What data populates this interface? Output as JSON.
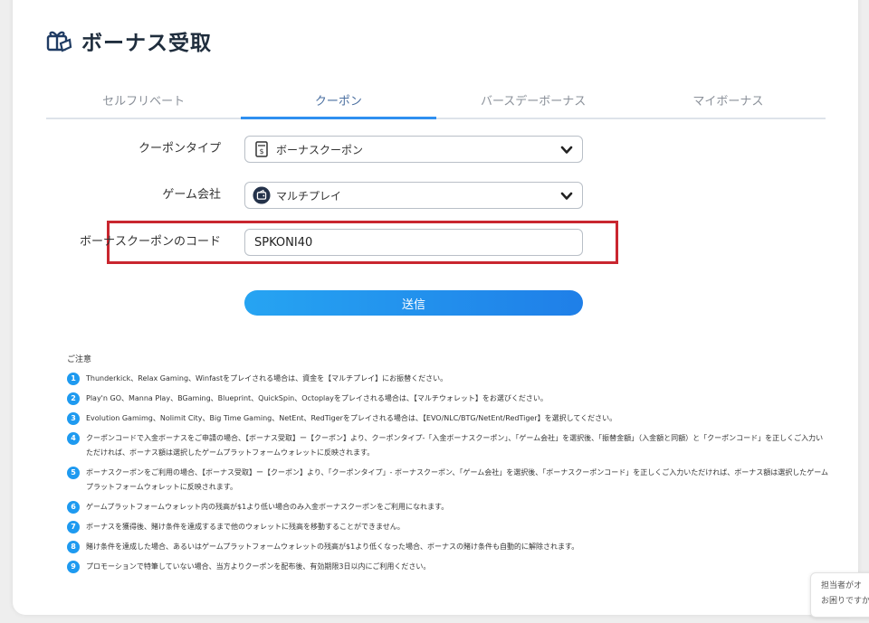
{
  "page": {
    "title": "ボーナス受取"
  },
  "tabs": [
    {
      "label": "セルフリベート",
      "active": false
    },
    {
      "label": "クーポン",
      "active": true
    },
    {
      "label": "バースデーボーナス",
      "active": false
    },
    {
      "label": "マイボーナス",
      "active": false
    }
  ],
  "form": {
    "coupon_type": {
      "label": "クーポンタイプ",
      "value": "ボーナスクーポン",
      "icon": "coupon-icon"
    },
    "game_company": {
      "label": "ゲーム会社",
      "value": "マルチプレイ",
      "icon": "wallet-icon"
    },
    "coupon_code": {
      "label": "ボーナスクーポンのコード",
      "value": "SPKONI40"
    },
    "submit_label": "送信"
  },
  "notes": {
    "title": "ご注意",
    "items": [
      {
        "num": "1",
        "text": "Thunderkick、Relax Gaming、Winfastをプレイされる場合は、資金を【マルチプレイ】にお振替ください。"
      },
      {
        "num": "2",
        "text": "Play'n GO、Manna Play、BGaming、Blueprint、QuickSpin、Octoplayをプレイされる場合は、【マルチウォレット】をお選びください。"
      },
      {
        "num": "3",
        "text": "Evolution Gamimg、Nolimit City、Big Time Gaming、NetEnt、RedTigerをプレイされる場合は、【EVO/NLC/BTG/NetEnt/RedTiger】を選択してください。"
      },
      {
        "num": "4",
        "text": "クーポンコードで入金ボーナスをご申請の場合、【ボーナス受取】ー【クーポン】より、クーポンタイプ-「入金ボーナスクーポン」、「ゲーム会社」を選択後、「振替金額」（入金額と同額）と「クーポンコード」を正しくご入力いただければ、ボーナス額は選択したゲームプラットフォームウォレットに反映されます。"
      },
      {
        "num": "5",
        "text": "ボーナスクーポンをご利用の場合、【ボーナス受取】ー【クーポン】より、「クーポンタイプ」- ボーナスクーポン、「ゲーム会社」を選択後、「ボーナスクーポンコード」を正しくご入力いただければ、ボーナス額は選択したゲームプラットフォームウォレットに反映されます。"
      },
      {
        "num": "6",
        "text": "ゲームプラットフォームウォレット内の残高が$1より低い場合のみ入金ボーナスクーポンをご利用になれます。"
      },
      {
        "num": "7",
        "text": "ボーナスを獲得後、賭け条件を達成するまで他のウォレットに残高を移動することができません。"
      },
      {
        "num": "8",
        "text": "賭け条件を達成した場合、あるいはゲームプラットフォームウォレットの残高が$1より低くなった場合、ボーナスの賭け条件も自動的に解除されます。"
      },
      {
        "num": "9",
        "text": "プロモーションで特筆していない場合、当方よりクーポンを配布後、有効期限3日以内にご利用ください。"
      }
    ]
  },
  "chat": {
    "line1": "担当者がオ",
    "line2": "お困りですか"
  },
  "colors": {
    "accent": "#2f8ff0",
    "highlight": "#c9262f",
    "badge": "#1e9af0"
  }
}
